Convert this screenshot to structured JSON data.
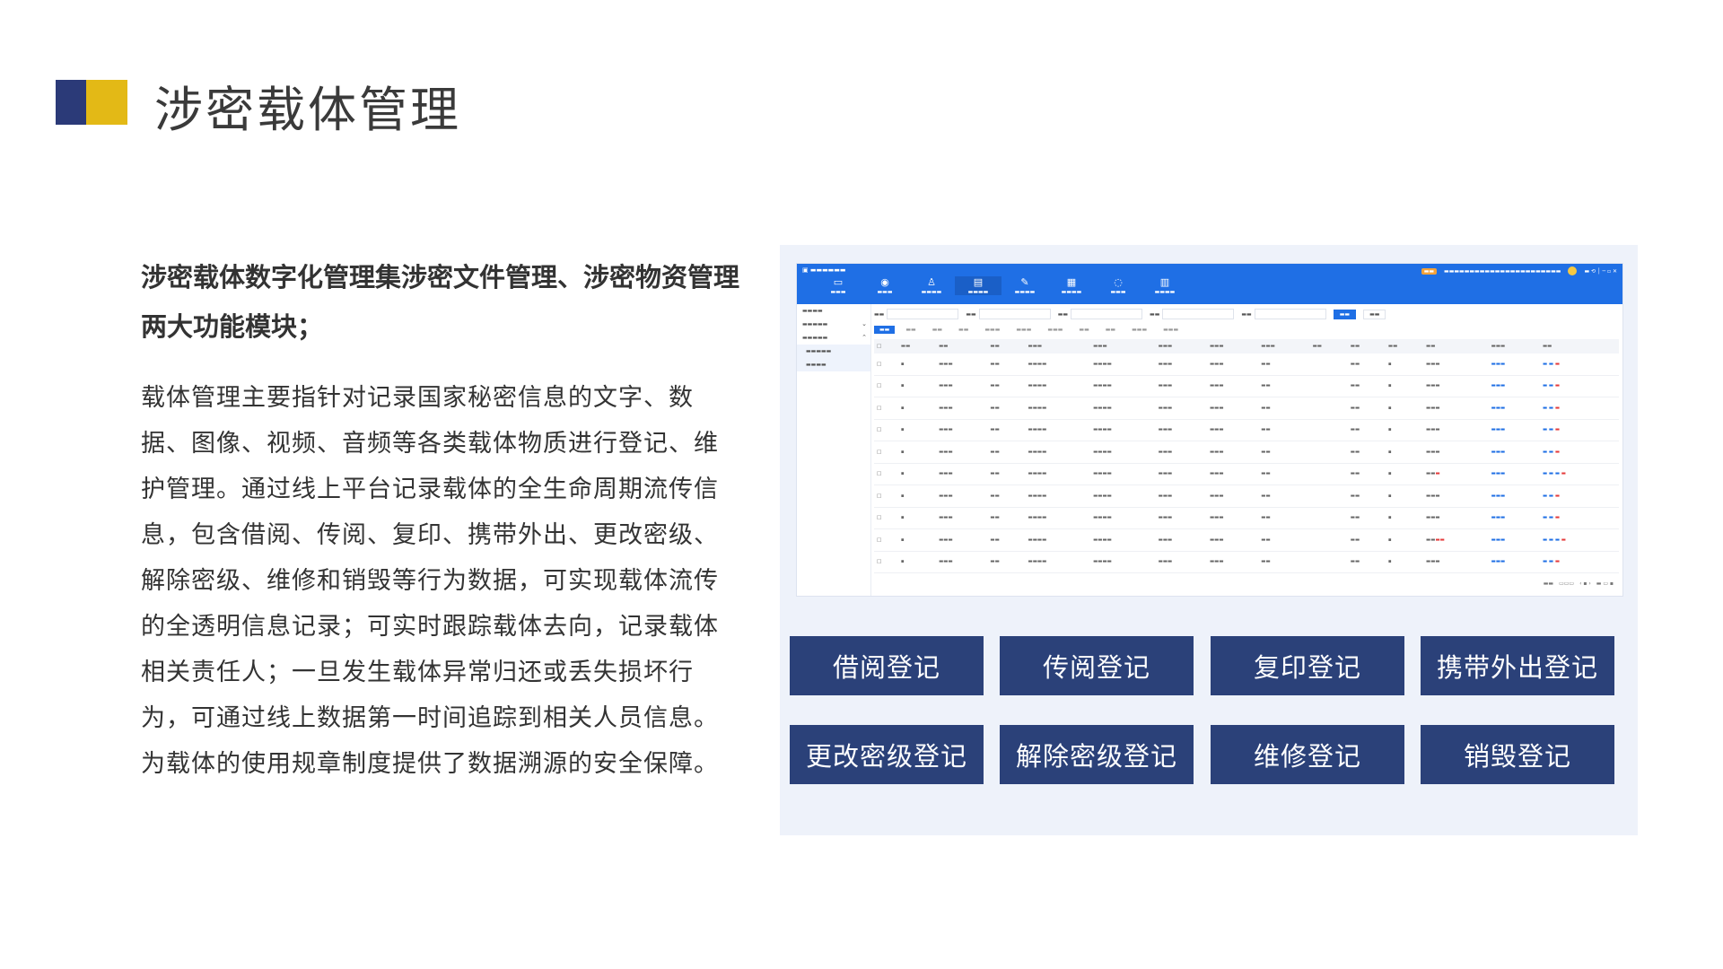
{
  "title": "涉密载体管理",
  "lead": "涉密载体数字化管理集涉密文件管理、涉密物资管理两大功能模块；",
  "body": "载体管理主要指针对记录国家秘密信息的文字、数据、图像、视频、音频等各类载体物质进行登记、维护管理。通过线上平台记录载体的全生命周期流传信息，包含借阅、传阅、复印、携带外出、更改密级、解除密级、维修和销毁等行为数据，可实现载体流传的全透明信息记录；可实时跟踪载体去向，记录载体相关责任人；一旦发生载体异常归还或丢失损坏行为，可通过线上数据第一时间追踪到相关人员信息。为载体的使用规章制度提供了数据溯源的安全保障。",
  "buttons": {
    "borrow": "借阅登记",
    "circulate": "传阅登记",
    "copy": "复印登记",
    "carry_out": "携带外出登记",
    "change_level": "更改密级登记",
    "declassify": "解除密级登记",
    "repair": "维修登记",
    "destroy": "销毁登记"
  },
  "colors": {
    "brand_blue": "#2b3a78",
    "brand_yellow": "#e3b916",
    "button_bg": "#2b4179",
    "app_blue": "#1f6fe5"
  }
}
